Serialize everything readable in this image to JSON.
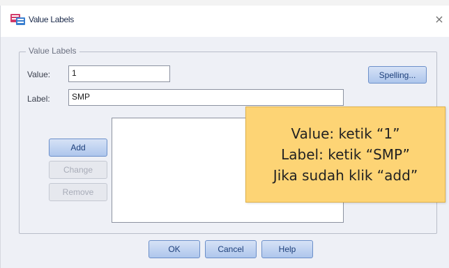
{
  "window": {
    "title": "Value Labels",
    "close_glyph": "×"
  },
  "group": {
    "legend": "Value Labels",
    "value_label": "Value:",
    "value_field": "1",
    "label_label": "Label:",
    "label_field": "SMP",
    "spelling_button": "Spelling...",
    "add_button": "Add",
    "change_button": "Change",
    "remove_button": "Remove"
  },
  "footer": {
    "ok": "OK",
    "cancel": "Cancel",
    "help": "Help"
  },
  "callout": {
    "line1": "Value: ketik “1”",
    "line2": "Label: ketik “SMP”",
    "line3": "Jika sudah klik “add”"
  },
  "colors": {
    "callout_bg": "#fdd475",
    "dialog_bg": "#eef0f6",
    "button_accent": "#aec6ec"
  },
  "icons": {
    "app": "spss-app-icon",
    "close": "close-icon"
  }
}
